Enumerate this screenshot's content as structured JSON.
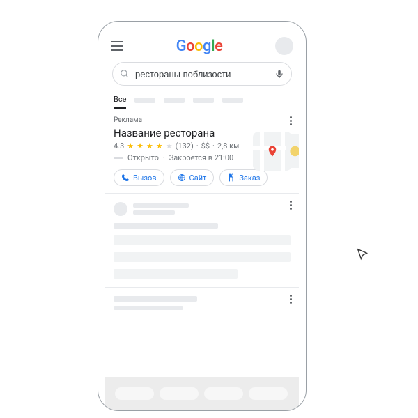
{
  "logo_letters": [
    "G",
    "o",
    "o",
    "g",
    "l",
    "e"
  ],
  "search": {
    "query": "рестораны поблизости",
    "placeholder": ""
  },
  "tabs": {
    "active": "Все"
  },
  "ad": {
    "label": "Реклама",
    "title": "Название ресторана",
    "rating": "4.3",
    "reviews": "(132)",
    "price": "$$",
    "distance": "2,8 км",
    "status_open": "Открыто",
    "status_close": "Закроется в 21:00",
    "actions": {
      "call": "Вызов",
      "site": "Сайт",
      "order": "Заказ"
    }
  }
}
